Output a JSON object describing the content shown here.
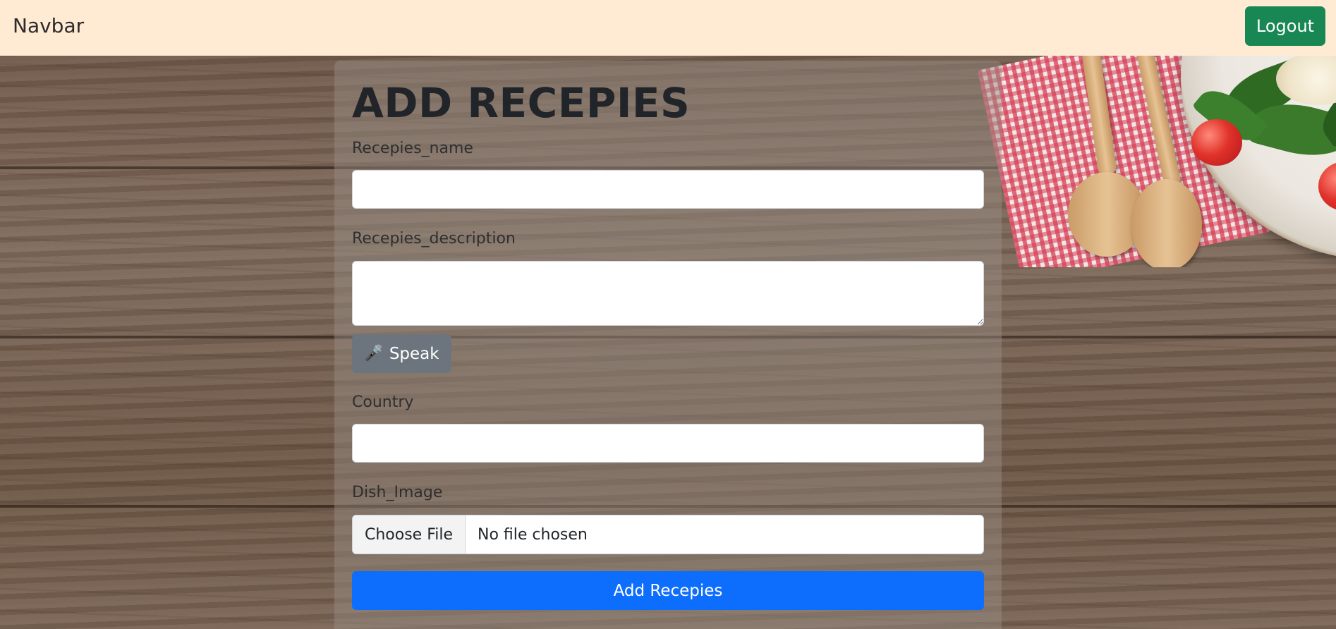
{
  "navbar": {
    "brand": "Navbar",
    "logout_label": "Logout"
  },
  "form": {
    "title": "ADD RECEPIES",
    "recipe_name": {
      "label": "Recepies_name",
      "value": ""
    },
    "recipe_description": {
      "label": "Recepies_description",
      "value": ""
    },
    "speak_button": {
      "icon": "microphone-icon",
      "label": "Speak"
    },
    "country": {
      "label": "Country",
      "value": ""
    },
    "dish_image": {
      "label": "Dish_Image",
      "button_label": "Choose File",
      "status": "No file chosen"
    },
    "submit_label": "Add Recepies"
  },
  "colors": {
    "navbar_bg": "#ffebd3",
    "logout_bg": "#198754",
    "speak_bg": "#6c757d",
    "submit_bg": "#0d6efd"
  }
}
